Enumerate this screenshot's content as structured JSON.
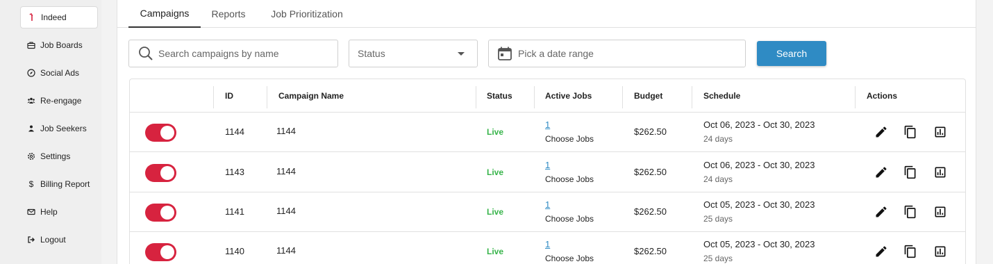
{
  "sidebar": {
    "items": [
      {
        "label": "Indeed",
        "icon": "indeed-icon",
        "active": true
      },
      {
        "label": "Job Boards",
        "icon": "briefcase-icon"
      },
      {
        "label": "Social Ads",
        "icon": "compass-icon"
      },
      {
        "label": "Re-engage",
        "icon": "users-icon"
      },
      {
        "label": "Job Seekers",
        "icon": "person-icon"
      },
      {
        "label": "Settings",
        "icon": "gear-icon"
      },
      {
        "label": "Billing Report",
        "icon": "dollar-icon"
      },
      {
        "label": "Help",
        "icon": "mail-icon"
      },
      {
        "label": "Logout",
        "icon": "logout-icon"
      }
    ]
  },
  "tabs": [
    {
      "label": "Campaigns",
      "active": true
    },
    {
      "label": "Reports"
    },
    {
      "label": "Job Prioritization"
    }
  ],
  "filters": {
    "search_placeholder": "Search campaigns by name",
    "status_label": "Status",
    "date_placeholder": "Pick a date range",
    "search_button": "Search"
  },
  "table": {
    "headers": {
      "id": "ID",
      "name": "Campaign Name",
      "status": "Status",
      "active_jobs": "Active Jobs",
      "budget": "Budget",
      "schedule": "Schedule",
      "actions": "Actions"
    },
    "rows": [
      {
        "id": "1144",
        "name": "1144",
        "status": "Live",
        "jobs": "1",
        "choose": "Choose Jobs",
        "budget": "$262.50",
        "schedule": "Oct 06, 2023 - Oct 30, 2023",
        "duration": "24 days"
      },
      {
        "id": "1143",
        "name": "1144",
        "status": "Live",
        "jobs": "1",
        "choose": "Choose Jobs",
        "budget": "$262.50",
        "schedule": "Oct 06, 2023 - Oct 30, 2023",
        "duration": "24 days"
      },
      {
        "id": "1141",
        "name": "1144",
        "status": "Live",
        "jobs": "1",
        "choose": "Choose Jobs",
        "budget": "$262.50",
        "schedule": "Oct 05, 2023 - Oct 30, 2023",
        "duration": "25 days"
      },
      {
        "id": "1140",
        "name": "1144",
        "status": "Live",
        "jobs": "1",
        "choose": "Choose Jobs",
        "budget": "$262.50",
        "schedule": "Oct 05, 2023 - Oct 30, 2023",
        "duration": "25 days"
      }
    ]
  },
  "colors": {
    "accent": "#2f8bc4",
    "toggle_on": "#d7233f",
    "live": "#37b44a"
  }
}
